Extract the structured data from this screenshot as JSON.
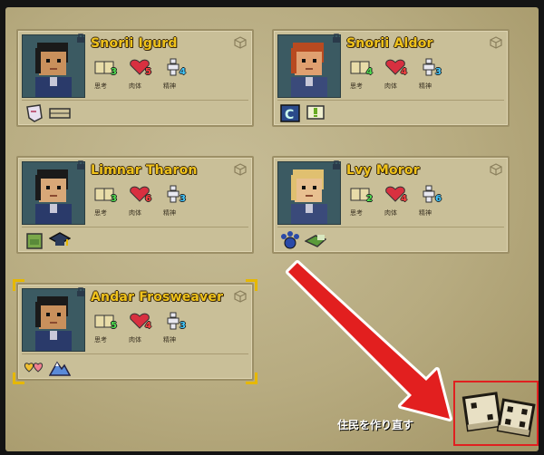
{
  "stat_labels": {
    "think": "思考",
    "body": "肉体",
    "mind": "精神"
  },
  "colors": {
    "think": "#4ee04e",
    "body": "#ff4040",
    "mind": "#40c8ff",
    "name": "#f0c31b"
  },
  "characters": [
    {
      "name": "Snorii Igurd",
      "think": "3",
      "body": "5",
      "mind": "4",
      "traits": [
        "paper-icon",
        "blanket-icon"
      ]
    },
    {
      "name": "Snorii Aldor",
      "think": "4",
      "body": "4",
      "mind": "3",
      "traits": [
        "letter-c-icon",
        "speech-exclaim-icon"
      ]
    },
    {
      "name": "Limnar Tharon",
      "think": "3",
      "body": "6",
      "mind": "3",
      "traits": [
        "backpack-icon",
        "graduation-cap-icon"
      ]
    },
    {
      "name": "Lvy Moror",
      "think": "2",
      "body": "4",
      "mind": "6",
      "traits": [
        "paw-icon",
        "goggles-icon"
      ]
    },
    {
      "name": "Andar Frosweaver",
      "think": "5",
      "body": "4",
      "mind": "3",
      "traits": [
        "hearts-icon",
        "mountain-icon"
      ]
    }
  ],
  "reroll_label": "住民を作り直す"
}
